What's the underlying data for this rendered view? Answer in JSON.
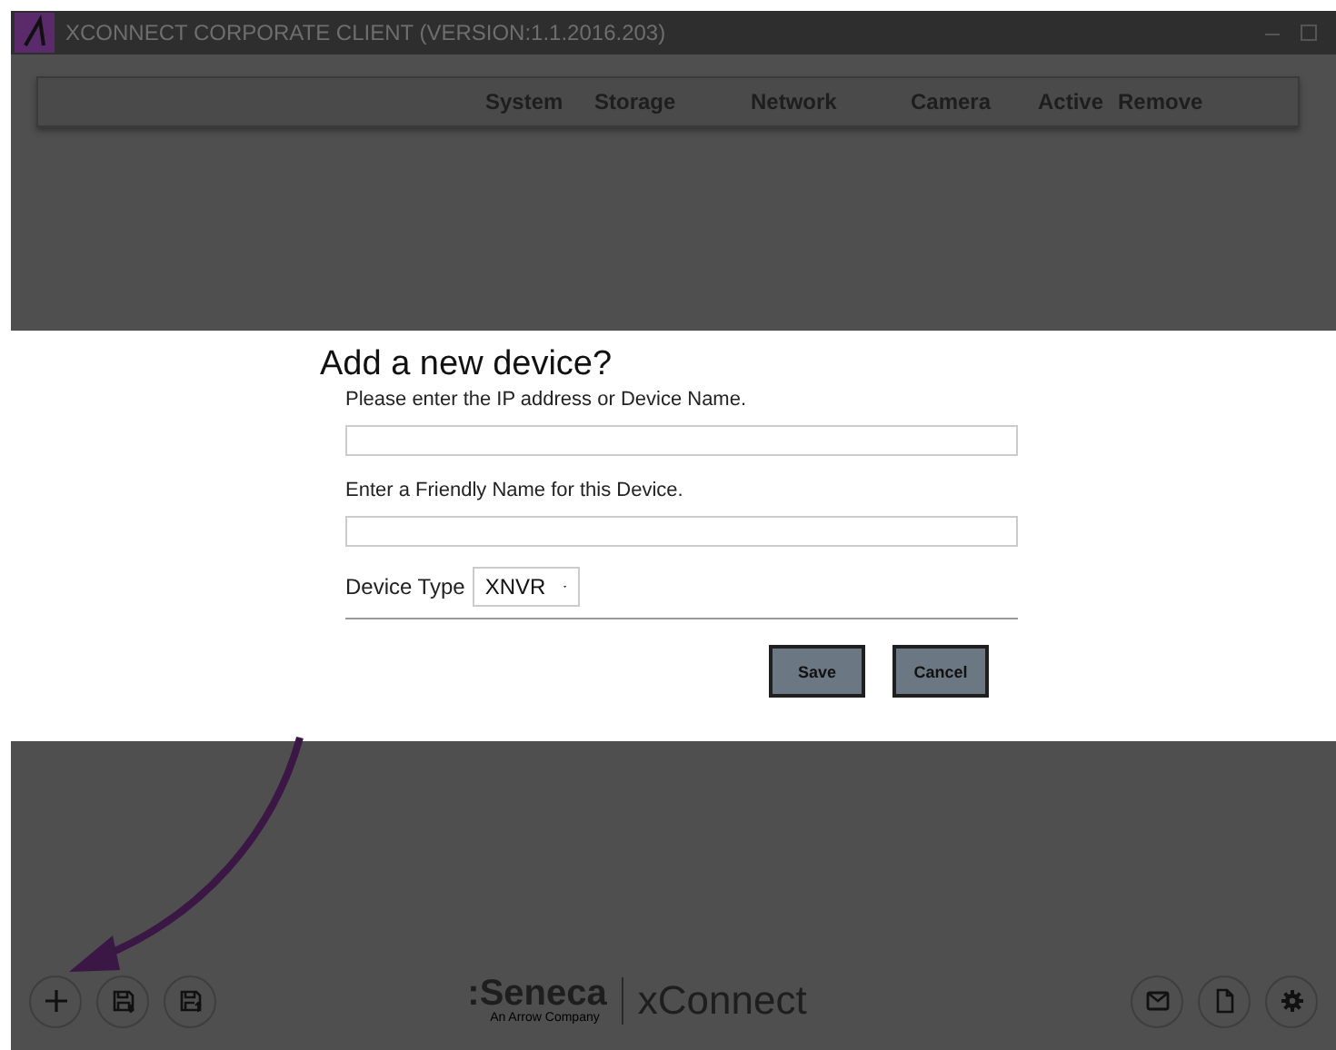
{
  "window": {
    "title": "XCONNECT CORPORATE CLIENT (VERSION:1.1.2016.203)"
  },
  "table": {
    "columns": [
      "System",
      "Storage",
      "Network",
      "Camera",
      "Active",
      "Remove"
    ]
  },
  "dialog": {
    "title": "Add a new device?",
    "fields": [
      {
        "label": "Please enter the IP address or Device Name."
      },
      {
        "label": "Enter a Friendly Name for this Device."
      }
    ],
    "device_type": {
      "label": "Device Type",
      "value": "XNVR"
    },
    "buttons": [
      "Save",
      "Cancel"
    ]
  },
  "footer": {
    "brand": ":Seneca",
    "tagline": "An Arrow Company",
    "product": "xConnect"
  }
}
